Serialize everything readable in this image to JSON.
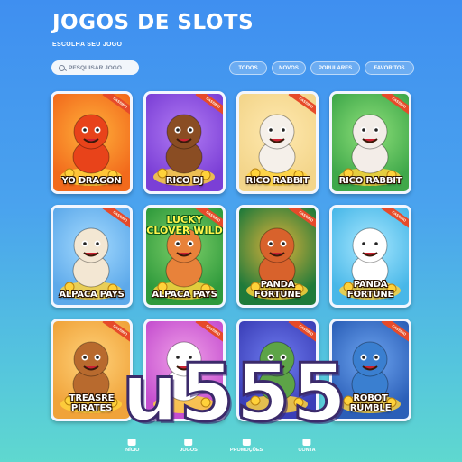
{
  "header": {
    "title": "JOGOS DE SLOTS",
    "subtitle": "ESCOLHA SEU JOGO"
  },
  "search": {
    "placeholder": "PESQUISAR JOGO..."
  },
  "filters": [
    "TODOS",
    "NOVOS",
    "POPULARES",
    "FAVORITOS"
  ],
  "ribbon": "CASSINO",
  "games": [
    {
      "name": "YO DRAGON",
      "bg": "#f26a1c",
      "bg2": "#ffb13b",
      "figure": "#e8431a"
    },
    {
      "name": "RICO DJ",
      "bg": "#7b3fd6",
      "bg2": "#b27cf4",
      "figure": "#8a4d23"
    },
    {
      "name": "RICO RABBIT",
      "bg": "#f3d58a",
      "bg2": "#ffe9b0",
      "figure": "#f5f0ea"
    },
    {
      "name": "RICO RABBIT",
      "bg": "#3fa84a",
      "bg2": "#8fe07a",
      "figure": "#f3ede8"
    },
    {
      "name": "ALPACA PAYS",
      "bg": "#5da9ea",
      "bg2": "#a5dbff",
      "figure": "#f3e7d3"
    },
    {
      "name": "ALPACA PAYS",
      "bg": "#2f9a3c",
      "bg2": "#7fd06a",
      "figure": "#e8823a",
      "headline": "LUCKY CLOVER WILD"
    },
    {
      "name": "PANDA FORTUNE",
      "bg": "#1f7a3a",
      "bg2": "#e3b33a",
      "figure": "#d8622c"
    },
    {
      "name": "PANDA FORTUNE",
      "bg": "#48b7e8",
      "bg2": "#a8e8ff",
      "figure": "#ffffff"
    },
    {
      "name": "TREASRE PIRATES",
      "bg": "#f0a33a",
      "bg2": "#ffd27a",
      "figure": "#b86a2e"
    },
    {
      "name": "",
      "bg": "#c54fcf",
      "bg2": "#f0a0e8",
      "figure": "#ffffff"
    },
    {
      "name": "",
      "bg": "#3b3fb8",
      "bg2": "#6f7cf0",
      "figure": "#5da447"
    },
    {
      "name": "ROBOT RUMBLE",
      "bg": "#2b5fb8",
      "bg2": "#6ea5f0",
      "figure": "#3a7fd0"
    }
  ],
  "nav": [
    {
      "label": "INÍCIO"
    },
    {
      "label": "JOGOS"
    },
    {
      "label": "PROMOÇÕES"
    },
    {
      "label": "CONTA"
    }
  ],
  "watermark": "u555"
}
